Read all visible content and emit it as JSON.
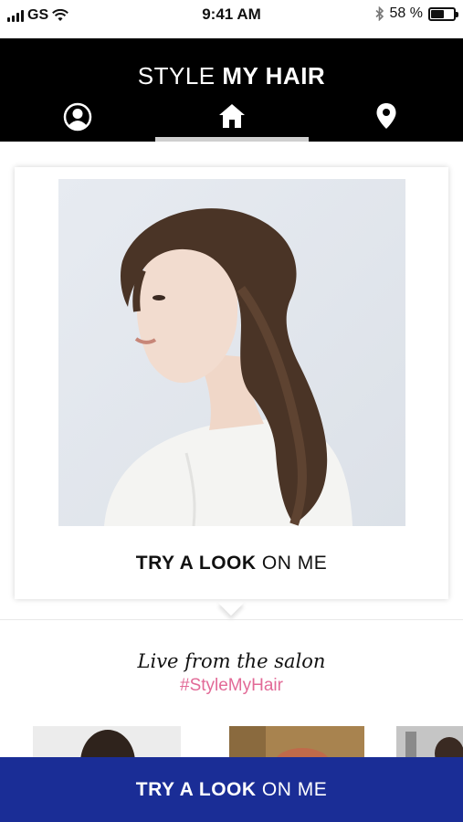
{
  "status_bar": {
    "carrier": "GS",
    "time": "9:41 AM",
    "battery_text": "58 %",
    "battery_level": 0.58,
    "icons": [
      "signal-icon",
      "wifi-icon",
      "bluetooth-icon",
      "battery-icon"
    ]
  },
  "header": {
    "title_light": "STYLE",
    "title_bold": "MY HAIR",
    "nav": [
      {
        "icon": "profile-icon"
      },
      {
        "icon": "home-icon",
        "active": true
      },
      {
        "icon": "location-pin-icon"
      }
    ]
  },
  "card": {
    "photo_alt": "hair-model-photo",
    "cta_bold": "TRY A LOOK",
    "cta_light": "ON ME"
  },
  "salon": {
    "title": "Live from the salon",
    "hashtag": "#StyleMyHair"
  },
  "bottom_bar": {
    "cta_bold": "TRY A LOOK",
    "cta_light": "ON ME",
    "color": "#1a2d96"
  },
  "colors": {
    "header_bg": "#000000",
    "hashtag": "#e26a97",
    "nav_indicator": "#cfcfcf"
  }
}
